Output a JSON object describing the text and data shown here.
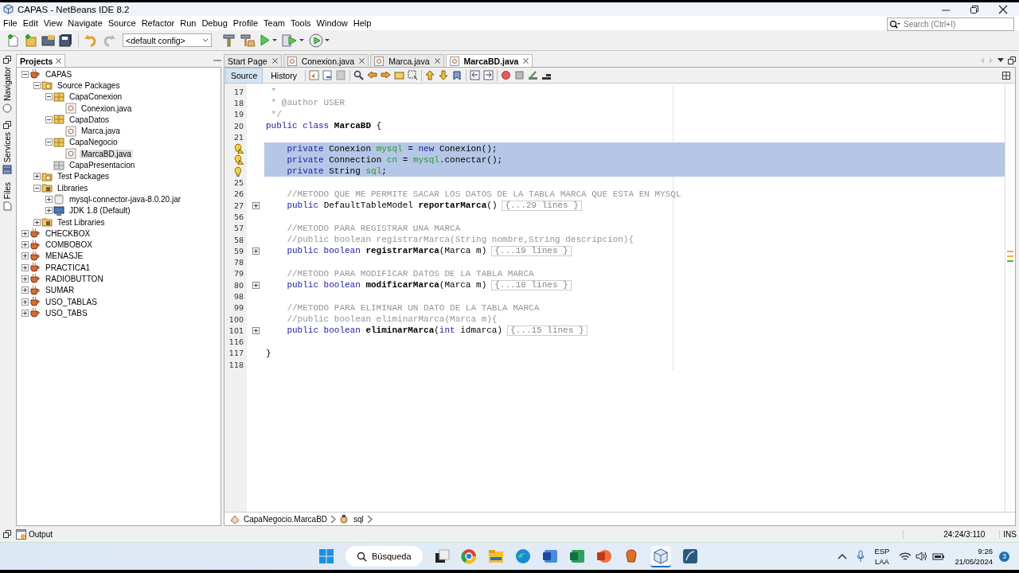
{
  "window": {
    "title": "CAPAS - NetBeans IDE 8.2"
  },
  "menu": [
    "File",
    "Edit",
    "View",
    "Navigate",
    "Source",
    "Refactor",
    "Run",
    "Debug",
    "Profile",
    "Team",
    "Tools",
    "Window",
    "Help"
  ],
  "toolbar": {
    "config": "<default config>"
  },
  "search": {
    "placeholder": "Search (Ctrl+I)"
  },
  "side_tabs": [
    "Navigator",
    "Services",
    "Files"
  ],
  "projects": {
    "title": "Projects",
    "tree": [
      {
        "label": "CAPAS",
        "kind": "project",
        "expanded": true,
        "selected": false,
        "children": [
          {
            "label": "Source Packages",
            "kind": "source-folder",
            "expanded": true,
            "selected": false,
            "children": [
              {
                "label": "CapaConexion",
                "kind": "package",
                "expanded": true,
                "selected": false,
                "children": [
                  {
                    "label": "Conexion.java",
                    "kind": "java",
                    "selected": false
                  }
                ]
              },
              {
                "label": "CapaDatos",
                "kind": "package",
                "expanded": true,
                "selected": false,
                "children": [
                  {
                    "label": "Marca.java",
                    "kind": "java",
                    "selected": false
                  }
                ]
              },
              {
                "label": "CapaNegocio",
                "kind": "package",
                "expanded": true,
                "selected": false,
                "children": [
                  {
                    "label": "MarcaBD.java",
                    "kind": "java",
                    "selected": true
                  }
                ]
              },
              {
                "label": "CapaPresentacion",
                "kind": "empty-package",
                "selected": false
              }
            ]
          },
          {
            "label": "Test Packages",
            "kind": "source-folder",
            "expanded": false,
            "selected": false
          },
          {
            "label": "Libraries",
            "kind": "library-folder",
            "expanded": true,
            "selected": false,
            "children": [
              {
                "label": "mysql-connector-java-8.0.20.jar",
                "kind": "jar",
                "expanded": false,
                "selected": false
              },
              {
                "label": "JDK 1.8 (Default)",
                "kind": "jdk",
                "expanded": false,
                "selected": false
              }
            ]
          },
          {
            "label": "Test Libraries",
            "kind": "library-folder",
            "expanded": false,
            "selected": false
          }
        ]
      },
      {
        "label": "CHECKBOX",
        "kind": "project",
        "expanded": false,
        "selected": false
      },
      {
        "label": "COMBOBOX",
        "kind": "project",
        "expanded": false,
        "selected": false
      },
      {
        "label": "MENASJE",
        "kind": "project",
        "expanded": false,
        "selected": false
      },
      {
        "label": "PRACTICA1",
        "kind": "project",
        "expanded": false,
        "selected": false
      },
      {
        "label": "RADIOBUTTON",
        "kind": "project",
        "expanded": false,
        "selected": false
      },
      {
        "label": "SUMAR",
        "kind": "project",
        "expanded": false,
        "selected": false
      },
      {
        "label": "USO_TABLAS",
        "kind": "project",
        "expanded": false,
        "selected": false
      },
      {
        "label": "USO_TABS",
        "kind": "project",
        "expanded": false,
        "selected": false
      }
    ]
  },
  "editor": {
    "tabs": [
      {
        "label": "Start Page",
        "kind": "page",
        "selected": false
      },
      {
        "label": "Conexion.java",
        "kind": "file",
        "selected": false
      },
      {
        "label": "Marca.java",
        "kind": "file",
        "selected": false
      },
      {
        "label": "MarcaBD.java",
        "kind": "file",
        "selected": true
      }
    ],
    "views": [
      {
        "label": "Source",
        "selected": true
      },
      {
        "label": "History",
        "selected": false
      }
    ],
    "lines": [
      {
        "kind": "code",
        "number": "17",
        "selected": false,
        "folded": false,
        "tokens": [
          {
            "kind": "comment",
            "text": " *"
          }
        ]
      },
      {
        "kind": "code",
        "number": "18",
        "selected": false,
        "folded": false,
        "tokens": [
          {
            "kind": "comment",
            "text": " * @author USER"
          }
        ]
      },
      {
        "kind": "code",
        "number": "19",
        "selected": false,
        "folded": false,
        "tokens": [
          {
            "kind": "comment",
            "text": " */"
          }
        ]
      },
      {
        "kind": "code",
        "number": "20",
        "selected": false,
        "folded": false,
        "tokens": [
          {
            "kind": "keyword",
            "text": "public class "
          },
          {
            "kind": "name",
            "text": "MarcaBD"
          },
          {
            "kind": "plain",
            "text": " {"
          }
        ]
      },
      {
        "kind": "code",
        "number": "21",
        "selected": false,
        "folded": false
      },
      {
        "kind": "warning",
        "selected": true,
        "folded": false,
        "tokens": [
          {
            "kind": "keyword",
            "text": "    private "
          },
          {
            "kind": "plain",
            "text": "Conexion "
          },
          {
            "kind": "field",
            "text": "mysql"
          },
          {
            "kind": "plain",
            "text": " = "
          },
          {
            "kind": "keyword",
            "text": "new "
          },
          {
            "kind": "plain",
            "text": "Conexion();"
          }
        ]
      },
      {
        "kind": "warning",
        "selected": true,
        "folded": false,
        "tokens": [
          {
            "kind": "keyword",
            "text": "    private "
          },
          {
            "kind": "plain",
            "text": "Connection "
          },
          {
            "kind": "field",
            "text": "cn"
          },
          {
            "kind": "plain",
            "text": " = "
          },
          {
            "kind": "field",
            "text": "mysql"
          },
          {
            "kind": "plain",
            "text": ".conectar();"
          }
        ]
      },
      {
        "kind": "suggestion",
        "selected": true,
        "folded": false,
        "tokens": [
          {
            "kind": "keyword",
            "text": "    private "
          },
          {
            "kind": "plain",
            "text": "String "
          },
          {
            "kind": "field",
            "text": "sql"
          },
          {
            "kind": "plain",
            "text": ";"
          }
        ]
      },
      {
        "kind": "code",
        "number": "25",
        "selected": false,
        "folded": false
      },
      {
        "kind": "code",
        "number": "26",
        "selected": false,
        "folded": false,
        "tokens": [
          {
            "kind": "comment",
            "text": "    //METODO QUE ME PERMITE SACAR LOS DATOS DE LA TABLA MARCA QUE ESTA EN MYSQL"
          }
        ]
      },
      {
        "kind": "code",
        "number": "27",
        "selected": false,
        "folded": true,
        "fold_text": "{...29 lines }",
        "tokens": [
          {
            "kind": "keyword",
            "text": "    public "
          },
          {
            "kind": "plain",
            "text": "DefaultTableModel "
          },
          {
            "kind": "name",
            "text": "reportarMarca"
          },
          {
            "kind": "plain",
            "text": "()"
          }
        ]
      },
      {
        "kind": "code",
        "number": "56",
        "selected": false,
        "folded": false
      },
      {
        "kind": "code",
        "number": "57",
        "selected": false,
        "folded": false,
        "tokens": [
          {
            "kind": "comment",
            "text": "    //METODO PARA REGISTRAR UNA MARCA"
          }
        ]
      },
      {
        "kind": "code",
        "number": "58",
        "selected": false,
        "folded": false,
        "tokens": [
          {
            "kind": "comment",
            "text": "    //public boolean registrarMarca(String nombre,String descripcion){"
          }
        ]
      },
      {
        "kind": "code",
        "number": "59",
        "selected": false,
        "folded": true,
        "fold_text": "{...19 lines }",
        "tokens": [
          {
            "kind": "keyword",
            "text": "    public boolean "
          },
          {
            "kind": "name",
            "text": "registrarMarca"
          },
          {
            "kind": "plain",
            "text": "(Marca m)"
          }
        ]
      },
      {
        "kind": "code",
        "number": "78",
        "selected": false,
        "folded": false
      },
      {
        "kind": "code",
        "number": "79",
        "selected": false,
        "folded": false,
        "tokens": [
          {
            "kind": "comment",
            "text": "    //METODO PARA MODIFICAR DATOS DE LA TABLA MARCA"
          }
        ]
      },
      {
        "kind": "code",
        "number": "80",
        "selected": false,
        "folded": true,
        "fold_text": "{...18 lines }",
        "tokens": [
          {
            "kind": "keyword",
            "text": "    public boolean "
          },
          {
            "kind": "name",
            "text": "modificarMarca"
          },
          {
            "kind": "plain",
            "text": "(Marca m)"
          }
        ]
      },
      {
        "kind": "code",
        "number": "98",
        "selected": false,
        "folded": false
      },
      {
        "kind": "code",
        "number": "99",
        "selected": false,
        "folded": false,
        "tokens": [
          {
            "kind": "comment",
            "text": "    //METODO PARA ELIMINAR UN DATO DE LA TABLA MARCA"
          }
        ]
      },
      {
        "kind": "code",
        "number": "100",
        "selected": false,
        "folded": false,
        "tokens": [
          {
            "kind": "comment",
            "text": "    //public boolean eliminarMarca(Marca m){"
          }
        ]
      },
      {
        "kind": "code",
        "number": "101",
        "selected": false,
        "folded": true,
        "fold_text": "{...15 lines }",
        "tokens": [
          {
            "kind": "keyword",
            "text": "    public boolean "
          },
          {
            "kind": "name",
            "text": "eliminarMarca"
          },
          {
            "kind": "plain",
            "text": "("
          },
          {
            "kind": "keyword",
            "text": "int "
          },
          {
            "kind": "plain",
            "text": "idmarca)"
          }
        ]
      },
      {
        "kind": "code",
        "number": "116",
        "selected": false,
        "folded": false
      },
      {
        "kind": "code",
        "number": "117",
        "selected": false,
        "folded": false,
        "tokens": [
          {
            "kind": "plain",
            "text": "}"
          }
        ]
      },
      {
        "kind": "code",
        "number": "118",
        "selected": false,
        "folded": false
      }
    ],
    "breadcrumb": [
      {
        "label": "CapaNegocio.MarcaBD",
        "kind": "class"
      },
      {
        "label": "sql",
        "kind": "field"
      }
    ]
  },
  "output": {
    "label": "Output"
  },
  "status_bar": {
    "position": "24:24/3:110",
    "mode": "INS"
  },
  "taskbar": {
    "search": "Búsqueda",
    "language": "ESP",
    "layout": "LAA",
    "time": "9:26",
    "date": "21/05/2024",
    "notifications": "3"
  }
}
